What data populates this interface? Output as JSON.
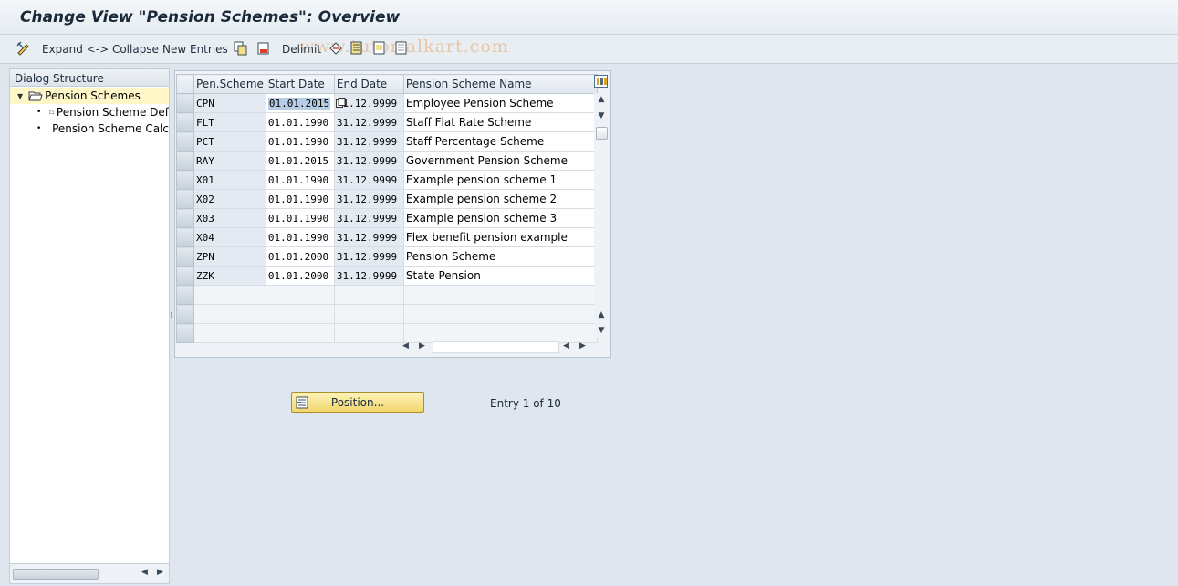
{
  "window": {
    "title": "Change View \"Pension Schemes\": Overview"
  },
  "toolbar": {
    "expand_collapse_label": "Expand <-> Collapse",
    "new_entries_label": "New Entries",
    "delimit_label": "Delimit",
    "watermark": "www.tutorialkart.com"
  },
  "dialog_structure": {
    "header": "Dialog Structure",
    "items": [
      {
        "label": "Pension Schemes",
        "selected": true,
        "level": 0
      },
      {
        "label": "Pension Scheme Def",
        "selected": false,
        "level": 1
      },
      {
        "label": "Pension Scheme Calc",
        "selected": false,
        "level": 1
      }
    ]
  },
  "table": {
    "columns": [
      "Pen.Scheme",
      "Start Date",
      "End Date",
      "Pension Scheme Name"
    ],
    "rows": [
      {
        "scheme": "CPN",
        "start": "01.01.2015",
        "end": "31.12.9999",
        "name": "Employee Pension Scheme"
      },
      {
        "scheme": "FLT",
        "start": "01.01.1990",
        "end": "31.12.9999",
        "name": "Staff Flat Rate Scheme"
      },
      {
        "scheme": "PCT",
        "start": "01.01.1990",
        "end": "31.12.9999",
        "name": "Staff Percentage Scheme"
      },
      {
        "scheme": "RAY",
        "start": "01.01.2015",
        "end": "31.12.9999",
        "name": "Government Pension Scheme"
      },
      {
        "scheme": "X01",
        "start": "01.01.1990",
        "end": "31.12.9999",
        "name": "Example pension scheme 1"
      },
      {
        "scheme": "X02",
        "start": "01.01.1990",
        "end": "31.12.9999",
        "name": "Example pension scheme 2"
      },
      {
        "scheme": "X03",
        "start": "01.01.1990",
        "end": "31.12.9999",
        "name": "Example pension scheme 3"
      },
      {
        "scheme": "X04",
        "start": "01.01.1990",
        "end": "31.12.9999",
        "name": "Flex benefit pension example"
      },
      {
        "scheme": "ZPN",
        "start": "01.01.2000",
        "end": "31.12.9999",
        "name": "Pension Scheme"
      },
      {
        "scheme": "ZZK",
        "start": "01.01.2000",
        "end": "31.12.9999",
        "name": "State Pension"
      }
    ]
  },
  "position_button": {
    "label": "Position..."
  },
  "entry_info": "Entry 1 of 10",
  "colors": {
    "selected_tree_bg": "#fff7c8",
    "button_yellow": "#f2d66e",
    "focus_border": "#d9402a"
  }
}
